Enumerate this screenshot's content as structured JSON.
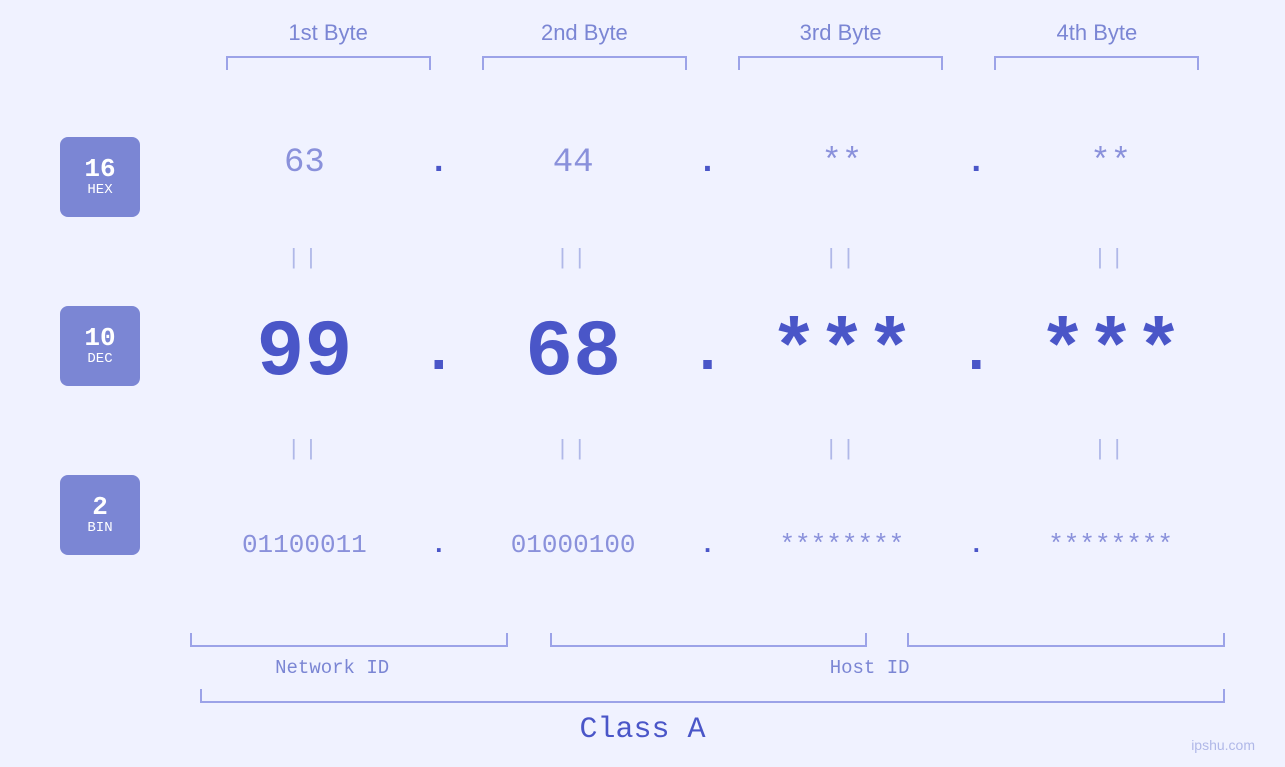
{
  "byteLabels": [
    "1st Byte",
    "2nd Byte",
    "3rd Byte",
    "4th Byte"
  ],
  "badges": [
    {
      "number": "16",
      "label": "HEX"
    },
    {
      "number": "10",
      "label": "DEC"
    },
    {
      "number": "2",
      "label": "BIN"
    }
  ],
  "rows": {
    "hex": {
      "values": [
        "63",
        "44",
        "**",
        "**"
      ],
      "dots": [
        ".",
        ".",
        ".",
        ""
      ]
    },
    "dec": {
      "values": [
        "99",
        "68",
        "***",
        "***"
      ],
      "dots": [
        ".",
        ".",
        ".",
        ""
      ]
    },
    "bin": {
      "values": [
        "01100011",
        "01000100",
        "********",
        "********"
      ],
      "dots": [
        ".",
        ".",
        ".",
        ""
      ]
    }
  },
  "separatorSymbol": "||",
  "networkLabel": "Network ID",
  "hostLabel": "Host ID",
  "classLabel": "Class A",
  "watermark": "ipshu.com"
}
